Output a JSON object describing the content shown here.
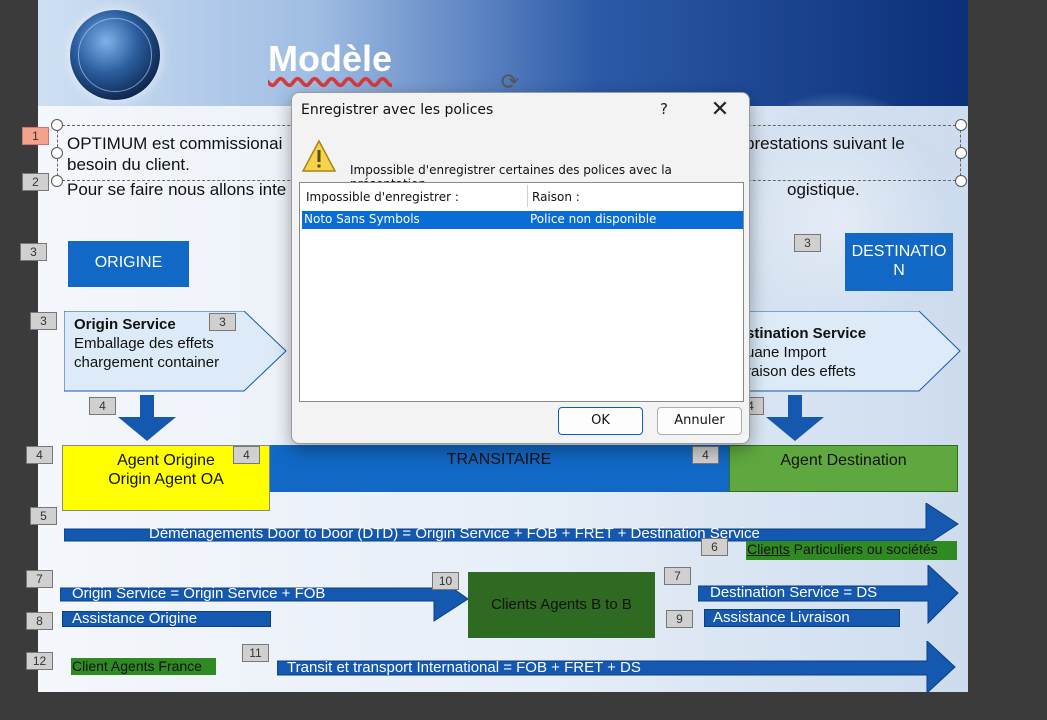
{
  "slide": {
    "title": "Modèle",
    "para1_left": "OPTIMUM est commissionai besoin du client.",
    "para1_right": "prestations suivant le",
    "para2_left": "Pour se faire nous allons inte",
    "para2_right": "ogistique.",
    "origine": "ORIGINE",
    "destination": "DESTINATIO N",
    "origin_service": {
      "heading": "Origin Service",
      "line1": "Emballage des effets",
      "line2": "chargement container"
    },
    "destination_service": {
      "heading": "stination Service",
      "line1": "uane Import",
      "line2": "raison des effets"
    },
    "agent_origine_line1": "Agent Origine",
    "agent_origine_line2": "Origin Agent OA",
    "transitaire": "TRANSITAIRE",
    "agent_destination": "Agent Destination",
    "dtd": "Déménagements Door to Door (DTD) = Origin Service + FOB + FRET + Destination Service",
    "clients_particuliers_a": "Clients",
    "clients_particuliers_b": " Particuliers ou sociétés",
    "origin_service_fob": "Origin Service = Origin Service + FOB",
    "assistance_origine": "Assistance Origine",
    "clients_agents_b2b": "Clients Agents B to B",
    "destination_service_ds": "Destination Service = DS",
    "assistance_livraison": "Assistance Livraison",
    "client_agents_france": "Client Agents France",
    "transit_international": "Transit et transport International = FOB + FRET + DS",
    "tags": {
      "t1": "1",
      "t2": "2",
      "t3a": "3",
      "t3b": "3",
      "t3c": "3",
      "t3d": "3",
      "t4a": "4",
      "t4b": "4",
      "t4c": "4",
      "t4d": "4",
      "t4e": "4",
      "t5": "5",
      "t6": "6",
      "t7a": "7",
      "t7b": "7",
      "t8": "8",
      "t9": "9",
      "t10": "10",
      "t11": "11",
      "t12": "12"
    }
  },
  "dialog": {
    "title": "Enregistrer avec les polices",
    "help": "?",
    "close": "✕",
    "message": "Impossible d'enregistrer certaines des polices avec la présentation.",
    "col1": "Impossible d'enregistrer :",
    "col2": "Raison :",
    "rows": [
      {
        "font": "Noto Sans Symbols",
        "reason": "Police non disponible"
      }
    ],
    "ok": "OK",
    "cancel": "Annuler"
  },
  "colors": {
    "accent_blue": "#1168c5",
    "agent_origine_yellow": "#ffff00",
    "agent_destination_green": "#5fa83f",
    "clients_b2b_green": "#2f6a22",
    "selection_blue": "#0a6cd6"
  },
  "icons": [
    "warning-icon",
    "rotate-icon",
    "globe-image",
    "help-icon",
    "close-icon"
  ]
}
